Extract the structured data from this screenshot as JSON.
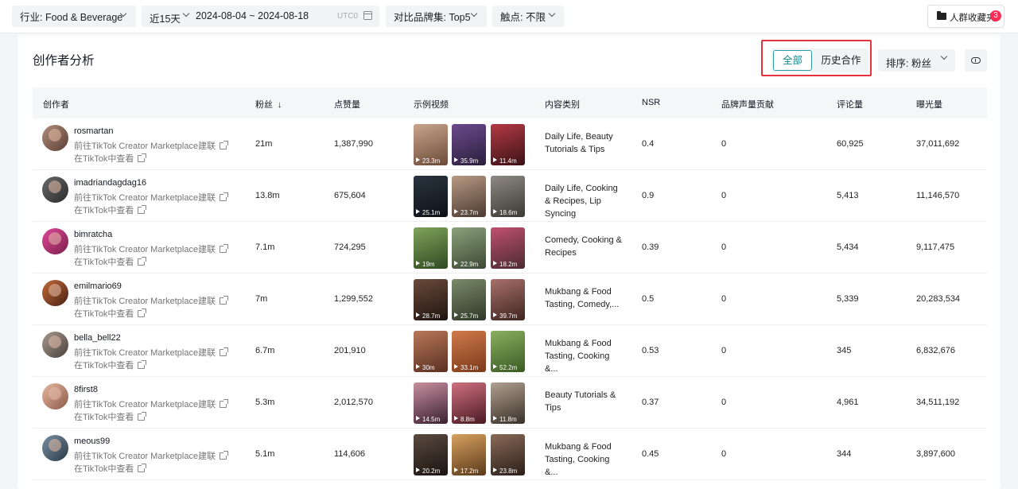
{
  "filters": {
    "industry": "行业: Food & Beverage",
    "range_label": "近15天",
    "date_range": "2024-08-04 ~ 2024-08-18",
    "timezone": "UTC0",
    "brand_set": "对比品牌集: Top5",
    "touchpoint": "触点: 不限"
  },
  "favorites": {
    "label": "人群收藏夹",
    "count": "3"
  },
  "section": {
    "title": "创作者分析",
    "segments": [
      "全部",
      "历史合作"
    ],
    "sort_label": "排序:  粉丝"
  },
  "table": {
    "headers": [
      "创作者",
      "粉丝",
      "点赞量",
      "示例视频",
      "内容类别",
      "NSR",
      "品牌声量贡献",
      "评论量",
      "曝光量"
    ],
    "link_marketplace": "前往TikTok Creator Marketplace建联",
    "link_tiktok": "在TikTok中查看",
    "rows": [
      {
        "handle": "rosmartan",
        "followers": "21m",
        "likes": "1,387,990",
        "videos": [
          "23.3m",
          "35.9m",
          "11.4m"
        ],
        "category": "Daily Life, Beauty Tutorials & Tips",
        "nsr": "0.4",
        "brand_voice": "0",
        "comments": "60,925",
        "impressions": "37,011,692"
      },
      {
        "handle": "imadriandagdag16",
        "followers": "13.8m",
        "likes": "675,604",
        "videos": [
          "25.1m",
          "23.7m",
          "18.6m"
        ],
        "category": "Daily Life, Cooking & Recipes, Lip Syncing",
        "nsr": "0.9",
        "brand_voice": "0",
        "comments": "5,413",
        "impressions": "11,146,570"
      },
      {
        "handle": "bimratcha",
        "followers": "7.1m",
        "likes": "724,295",
        "videos": [
          "19m",
          "22.9m",
          "18.2m"
        ],
        "category": "Comedy, Cooking & Recipes",
        "nsr": "0.39",
        "brand_voice": "0",
        "comments": "5,434",
        "impressions": "9,117,475"
      },
      {
        "handle": "emilmario69",
        "followers": "7m",
        "likes": "1,299,552",
        "videos": [
          "28.7m",
          "25.7m",
          "39.7m"
        ],
        "category": "Mukbang & Food Tasting, Comedy,...",
        "nsr": "0.5",
        "brand_voice": "0",
        "comments": "5,339",
        "impressions": "20,283,534"
      },
      {
        "handle": "bella_bell22",
        "followers": "6.7m",
        "likes": "201,910",
        "videos": [
          "30m",
          "33.1m",
          "52.2m"
        ],
        "category": "Mukbang & Food Tasting, Cooking &...",
        "nsr": "0.53",
        "brand_voice": "0",
        "comments": "345",
        "impressions": "6,832,676"
      },
      {
        "handle": "8first8",
        "followers": "5.3m",
        "likes": "2,012,570",
        "videos": [
          "14.5m",
          "8.8m",
          "11.8m"
        ],
        "category": "Beauty Tutorials & Tips",
        "nsr": "0.37",
        "brand_voice": "0",
        "comments": "4,961",
        "impressions": "34,511,192"
      },
      {
        "handle": "meous99",
        "followers": "5.1m",
        "likes": "114,606",
        "videos": [
          "20.2m",
          "17.2m",
          "23.8m"
        ],
        "category": "Mukbang & Food Tasting, Cooking &...",
        "nsr": "0.45",
        "brand_voice": "0",
        "comments": "344",
        "impressions": "3,897,600"
      }
    ]
  },
  "colors": {
    "accent": "#17868f",
    "highlight": "#e5323f",
    "badge": "#fe2c55"
  }
}
